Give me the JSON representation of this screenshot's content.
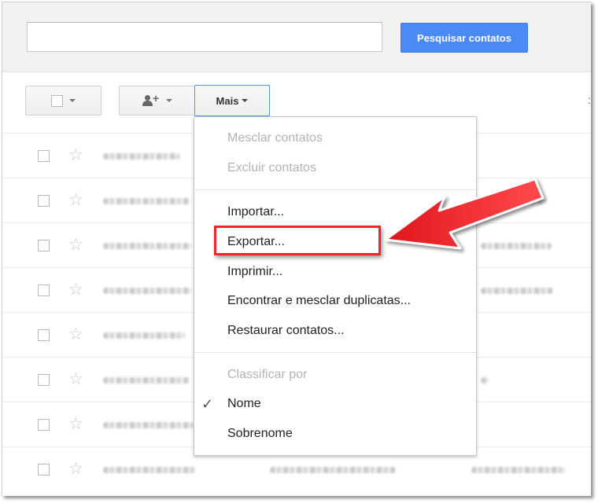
{
  "search": {
    "value": "",
    "button_label": "Pesquisar contatos"
  },
  "toolbar": {
    "more_label": "Mais"
  },
  "menu": {
    "merge": "Mesclar contatos",
    "delete": "Excluir contatos",
    "import": "Importar...",
    "export": "Exportar...",
    "print": "Imprimir...",
    "find_duplicates": "Encontrar e mesclar duplicatas...",
    "restore": "Restaurar contatos...",
    "sort_header": "Classificar por",
    "sort_name": "Nome",
    "sort_surname": "Sobrenome",
    "checked_icon": "checkmark-icon"
  },
  "colors": {
    "accent": "#4a8af4",
    "annotation": "#f1252a"
  },
  "contacts": {
    "row_count": 8,
    "content": "blurred"
  }
}
